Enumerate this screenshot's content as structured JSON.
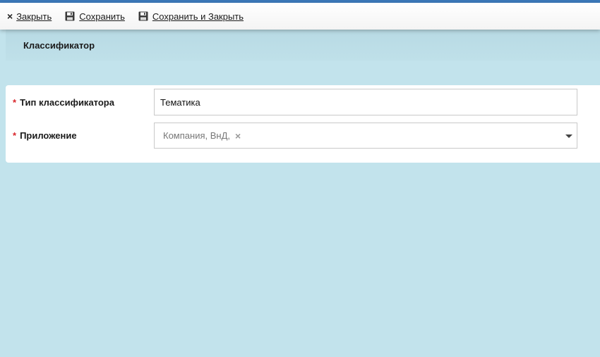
{
  "toolbar": {
    "close_label": "Закрыть",
    "save_label": "Сохранить",
    "save_close_label": "Сохранить и Закрыть",
    "close_icon": "×"
  },
  "header": {
    "title": "Классификатор"
  },
  "form": {
    "required_mark": "*",
    "type_label": "Тип классификатора",
    "type_value": "Тематика",
    "app_label": "Приложение",
    "app_value": "Компания, ВнД,",
    "clear_icon": "×"
  },
  "colors": {
    "top_accent": "#3b78b8",
    "background": "#c2e3ec",
    "required": "#d9262b"
  }
}
